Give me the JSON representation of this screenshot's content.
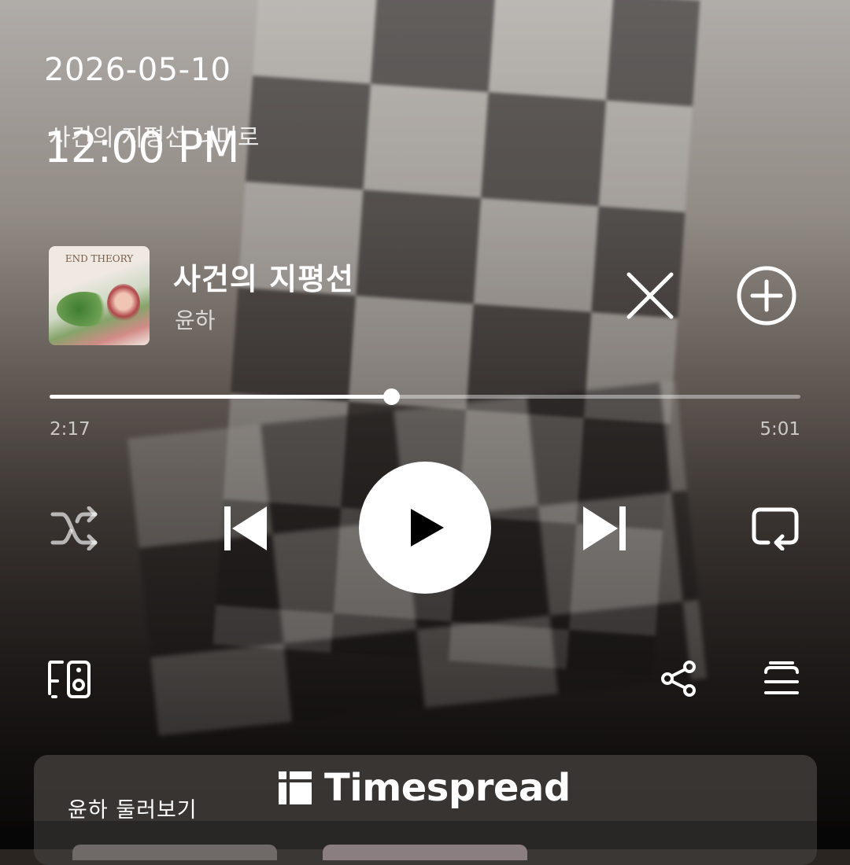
{
  "status": {
    "date": "2026-05-10",
    "time": "12:00 PM"
  },
  "background_lyric": "사건의 지평선 너머로",
  "now_playing": {
    "title": "사건의 지평선",
    "artist": "윤하",
    "album_art_text": "END THEORY"
  },
  "progress": {
    "elapsed": "2:17",
    "total": "5:01",
    "fraction": 0.455
  },
  "controls": {
    "shuffle_icon": "shuffle-icon",
    "prev_icon": "skip-previous-icon",
    "play_icon": "play-icon",
    "next_icon": "skip-next-icon",
    "repeat_icon": "repeat-icon",
    "close_icon": "close-icon",
    "add_icon": "add-circle-icon",
    "device_icon": "device-speaker-icon",
    "share_icon": "share-icon",
    "queue_icon": "queue-icon"
  },
  "panel": {
    "title": "윤하 둘러보기"
  },
  "watermark": {
    "text": "Timespread"
  }
}
